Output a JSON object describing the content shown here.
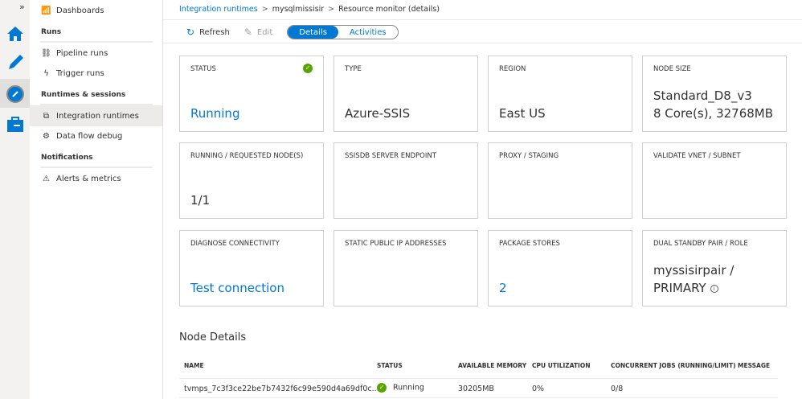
{
  "nav": {
    "items": [
      {
        "label": "Dashboards",
        "icon": "dashboard-icon"
      },
      {
        "label": "Pipeline runs",
        "icon": "pipeline-icon"
      },
      {
        "label": "Trigger runs",
        "icon": "trigger-icon"
      },
      {
        "label": "Integration runtimes",
        "icon": "integration-runtime-icon"
      },
      {
        "label": "Data flow debug",
        "icon": "data-flow-icon"
      },
      {
        "label": "Alerts & metrics",
        "icon": "warning-icon"
      }
    ],
    "sections": {
      "runs": "Runs",
      "runtimes": "Runtimes & sessions",
      "notifications": "Notifications"
    }
  },
  "breadcrumb": [
    "Integration runtimes",
    "mysqlmissisir",
    "Resource monitor (details)"
  ],
  "toolbar": {
    "refresh": "Refresh",
    "edit": "Edit",
    "tabs": [
      "Details",
      "Activities"
    ],
    "active_tab": "Details"
  },
  "cards": [
    {
      "label": "STATUS",
      "value": "Running"
    },
    {
      "label": "TYPE",
      "value": "Azure-SSIS"
    },
    {
      "label": "REGION",
      "value": "East US"
    },
    {
      "label": "NODE SIZE",
      "value": "Standard_D8_v3",
      "value2": "8 Core(s), 32768MB"
    },
    {
      "label": "RUNNING / REQUESTED NODE(S)",
      "value": "1/1"
    },
    {
      "label": "SSISDB SERVER ENDPOINT",
      "value": ""
    },
    {
      "label": "PROXY / STAGING",
      "value": ""
    },
    {
      "label": "VALIDATE VNET / SUBNET",
      "value": ""
    },
    {
      "label": "DIAGNOSE CONNECTIVITY",
      "value": "Test connection"
    },
    {
      "label": "STATIC PUBLIC IP ADDRESSES",
      "value": ""
    },
    {
      "label": "PACKAGE STORES",
      "value": "2"
    },
    {
      "label": "DUAL STANDBY PAIR / ROLE",
      "value": "myssisirpair /",
      "value2": "PRIMARY"
    }
  ],
  "node_details": {
    "title": "Node Details",
    "columns": [
      "NAME",
      "STATUS",
      "AVAILABLE MEMORY",
      "CPU UTILIZATION",
      "CONCURRENT JOBS (RUNNING/LIMIT)",
      "MESSAGE"
    ],
    "rows": [
      [
        "tvmps_7c3f3ce22be7b7432f6c99e590d4a69df0c...",
        "Running",
        "30205MB",
        "0%",
        "0/8",
        ""
      ]
    ]
  },
  "colors": {
    "accent": "#0078d4",
    "success": "#57a300"
  }
}
